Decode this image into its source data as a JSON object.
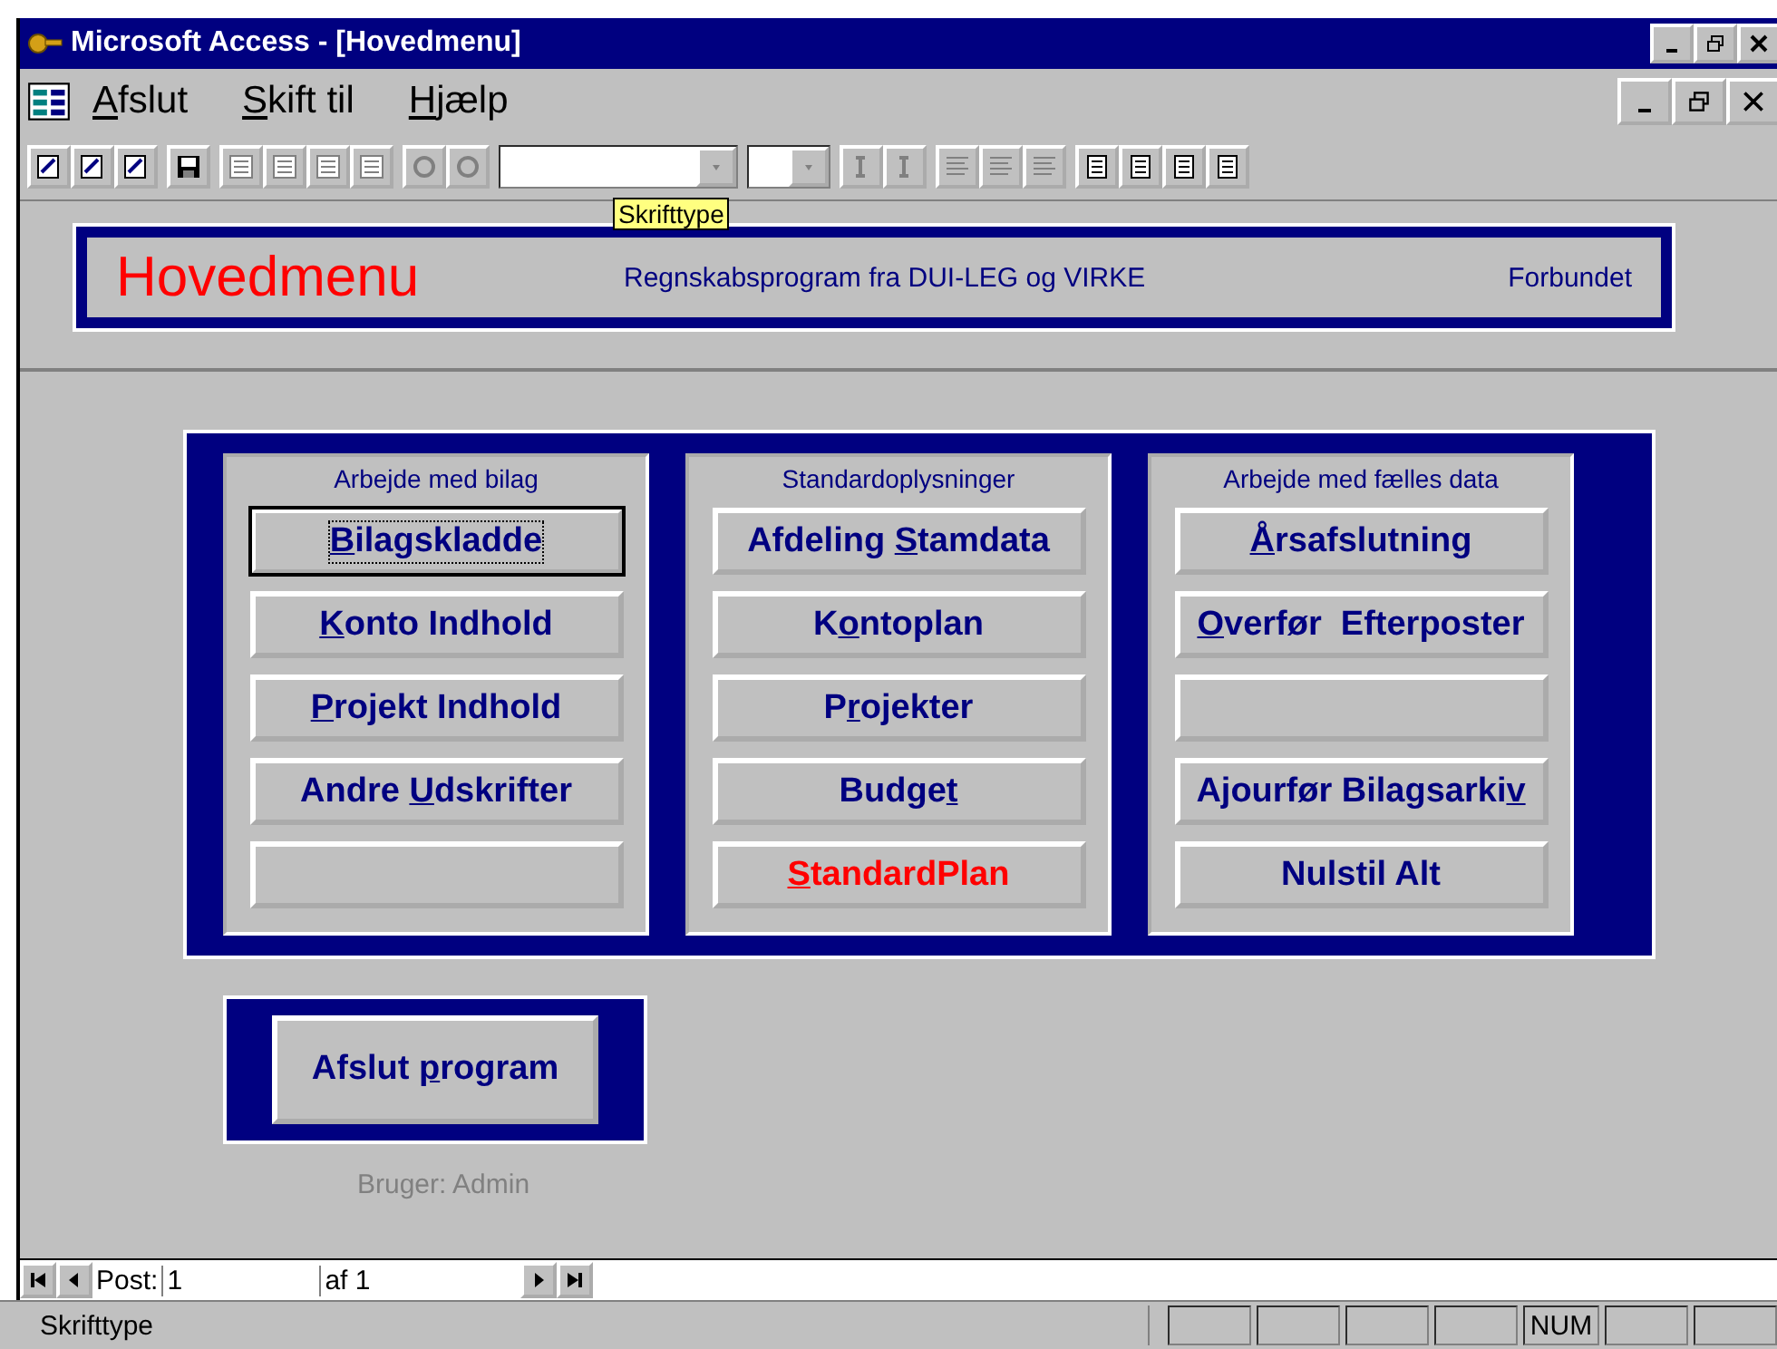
{
  "window": {
    "title": "Microsoft Access - [Hovedmenu]"
  },
  "menu": [
    {
      "key": "A",
      "after": "fslut"
    },
    {
      "key": "S",
      "after": "kift til"
    },
    {
      "key": "H",
      "after": "jælp"
    }
  ],
  "toolbar": {
    "tooltip": "Skrifttype"
  },
  "header": {
    "title": "Hovedmenu",
    "subtitle": "Regnskabsprogram fra DUI-LEG og VIRKE",
    "right": "Forbundet"
  },
  "groups": [
    {
      "heading": "Arbejde med bilag",
      "buttons": [
        {
          "key": "B",
          "after": "ilagskladde",
          "color": "#000080",
          "focused": true
        },
        {
          "key": "K",
          "after": "onto Indhold",
          "color": "#000080",
          "focused": false
        },
        {
          "key": "P",
          "after": "rojekt Indhold",
          "color": "#000080",
          "focused": false
        },
        {
          "before": "Andre ",
          "key": "U",
          "after": "dskrifter",
          "color": "#000080",
          "focused": false
        },
        {
          "focused": false
        }
      ]
    },
    {
      "heading": "Standardoplysninger",
      "buttons": [
        {
          "before": "Afdeling ",
          "key": "S",
          "after": "tamdata",
          "color": "#000080",
          "focused": false
        },
        {
          "before": "K",
          "key": "o",
          "after": "ntoplan",
          "color": "#000080",
          "focused": false
        },
        {
          "before": "P",
          "key": "r",
          "after": "ojekter",
          "color": "#000080",
          "focused": false
        },
        {
          "before": "Budge",
          "key": "t",
          "color": "#000080",
          "focused": false
        },
        {
          "key": "S",
          "after": "tandardPlan",
          "color": "#ff0000",
          "focused": false
        }
      ]
    },
    {
      "heading": "Arbejde med fælles data",
      "buttons": [
        {
          "key": "Å",
          "after": "rsafslutning",
          "color": "#000080",
          "focused": false
        },
        {
          "key": "O",
          "after": "verfør  Efterposter",
          "color": "#000080",
          "focused": false
        },
        {
          "focused": false
        },
        {
          "before": "Ajourfør Bilagsarki",
          "key": "v",
          "color": "#000080",
          "focused": false
        },
        {
          "before": "Nulstil Alt",
          "color": "#000080",
          "focused": false
        }
      ]
    }
  ],
  "exit_button": {
    "before": "Afslut ",
    "key": "p",
    "after": "rogram",
    "color": "#000080",
    "focused": false
  },
  "user": "Bruger: Admin",
  "navigation": {
    "label": "Post:",
    "current": "1",
    "total": "af 1"
  },
  "status_bar": {
    "text": "Skrifttype",
    "indicators": [
      "NUM"
    ]
  }
}
